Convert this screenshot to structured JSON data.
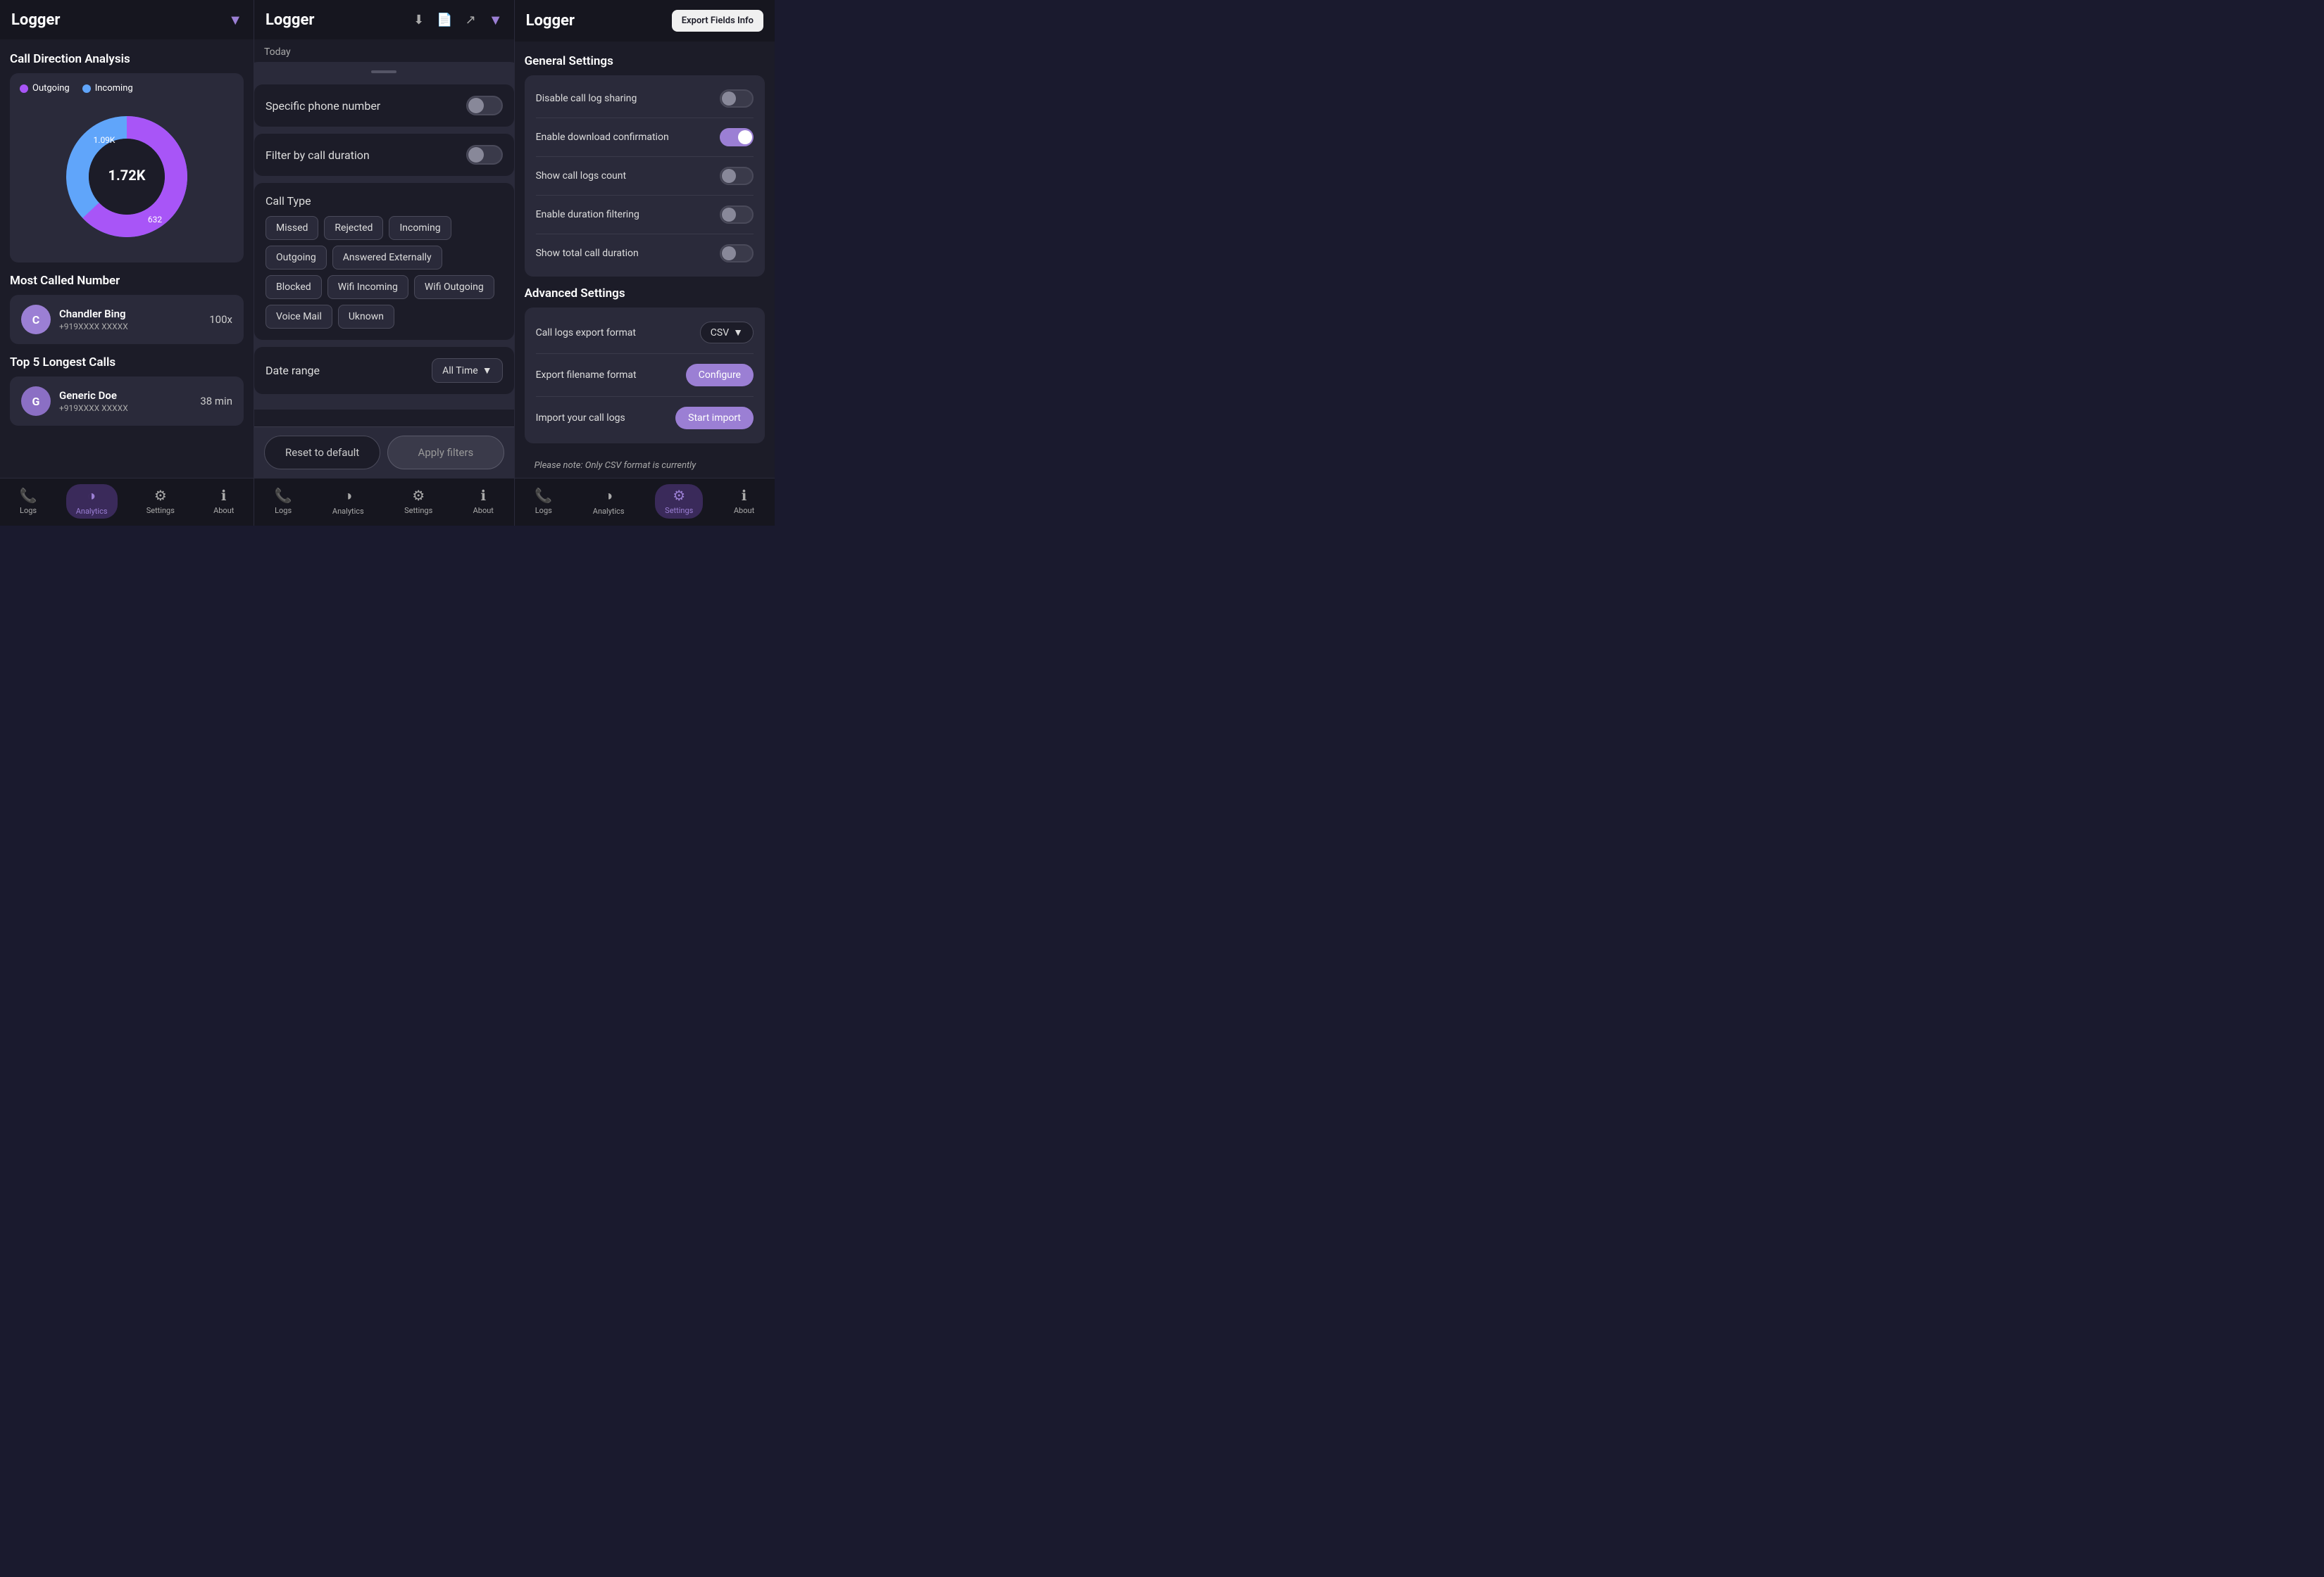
{
  "left": {
    "header": {
      "title": "Logger",
      "filter_icon": "▼"
    },
    "call_direction": {
      "title": "Call Direction Analysis",
      "legend": {
        "outgoing": "Outgoing",
        "incoming": "Incoming"
      },
      "total": "1.72K",
      "outgoing_value": "1.09K",
      "incoming_value": "632",
      "outgoing_percent": 63,
      "incoming_percent": 37
    },
    "most_called": {
      "title": "Most Called Number",
      "avatar_letter": "C",
      "name": "Chandler Bing",
      "number": "+919XXXX XXXXX",
      "count": "100x"
    },
    "top_calls": {
      "title": "Top 5 Longest Calls",
      "items": [
        {
          "avatar_letter": "G",
          "name": "Generic Doe",
          "number": "+919XXXX XXXXX",
          "duration": "38 min"
        }
      ]
    },
    "nav": [
      {
        "id": "logs",
        "icon": "📞",
        "label": "Logs",
        "active": false
      },
      {
        "id": "analytics",
        "icon": "◑",
        "label": "Analytics",
        "active": true
      },
      {
        "id": "settings",
        "icon": "⚙",
        "label": "Settings",
        "active": false
      },
      {
        "id": "about",
        "icon": "ℹ",
        "label": "About",
        "active": false
      }
    ]
  },
  "middle": {
    "header": {
      "title": "Logger",
      "icons": [
        "download",
        "file",
        "share",
        "filter"
      ]
    },
    "date_label": "Today",
    "filters": {
      "specific_phone": {
        "label": "Specific phone number",
        "enabled": false
      },
      "call_duration": {
        "label": "Filter by call duration",
        "enabled": false
      },
      "call_type": {
        "title": "Call Type",
        "chips": [
          {
            "label": "Missed",
            "selected": false
          },
          {
            "label": "Rejected",
            "selected": false
          },
          {
            "label": "Incoming",
            "selected": false
          },
          {
            "label": "Outgoing",
            "selected": false
          },
          {
            "label": "Answered Externally",
            "selected": false
          },
          {
            "label": "Blocked",
            "selected": false
          },
          {
            "label": "Wifi Incoming",
            "selected": false
          },
          {
            "label": "Wifi Outgoing",
            "selected": false
          },
          {
            "label": "Voice Mail",
            "selected": false
          },
          {
            "label": "Uknown",
            "selected": false
          }
        ]
      },
      "date_range": {
        "label": "Date range",
        "value": "All Time"
      }
    },
    "actions": {
      "reset": "Reset to default",
      "apply": "Apply filters"
    }
  },
  "right": {
    "header": {
      "title": "Logger",
      "export_btn": "Export Fields Info"
    },
    "general_settings": {
      "title": "General Settings",
      "items": [
        {
          "label": "Disable call log sharing",
          "enabled": false
        },
        {
          "label": "Enable download confirmation",
          "enabled": true
        },
        {
          "label": "Show call logs count",
          "enabled": false
        },
        {
          "label": "Enable duration filtering",
          "enabled": false
        },
        {
          "label": "Show total call duration",
          "enabled": false
        }
      ]
    },
    "advanced_settings": {
      "title": "Advanced Settings",
      "export_format": {
        "label": "Call logs export format",
        "value": "CSV"
      },
      "export_filename": {
        "label": "Export filename format",
        "btn": "Configure"
      },
      "import": {
        "label": "Import your call logs",
        "btn": "Start import"
      }
    },
    "note": "Please note: Only CSV format is currently",
    "nav": [
      {
        "id": "logs",
        "icon": "📞",
        "label": "Logs",
        "active": false
      },
      {
        "id": "analytics",
        "icon": "◑",
        "label": "Analytics",
        "active": false
      },
      {
        "id": "settings",
        "icon": "⚙",
        "label": "Settings",
        "active": true
      },
      {
        "id": "about",
        "icon": "ℹ",
        "label": "About",
        "active": false
      }
    ]
  }
}
